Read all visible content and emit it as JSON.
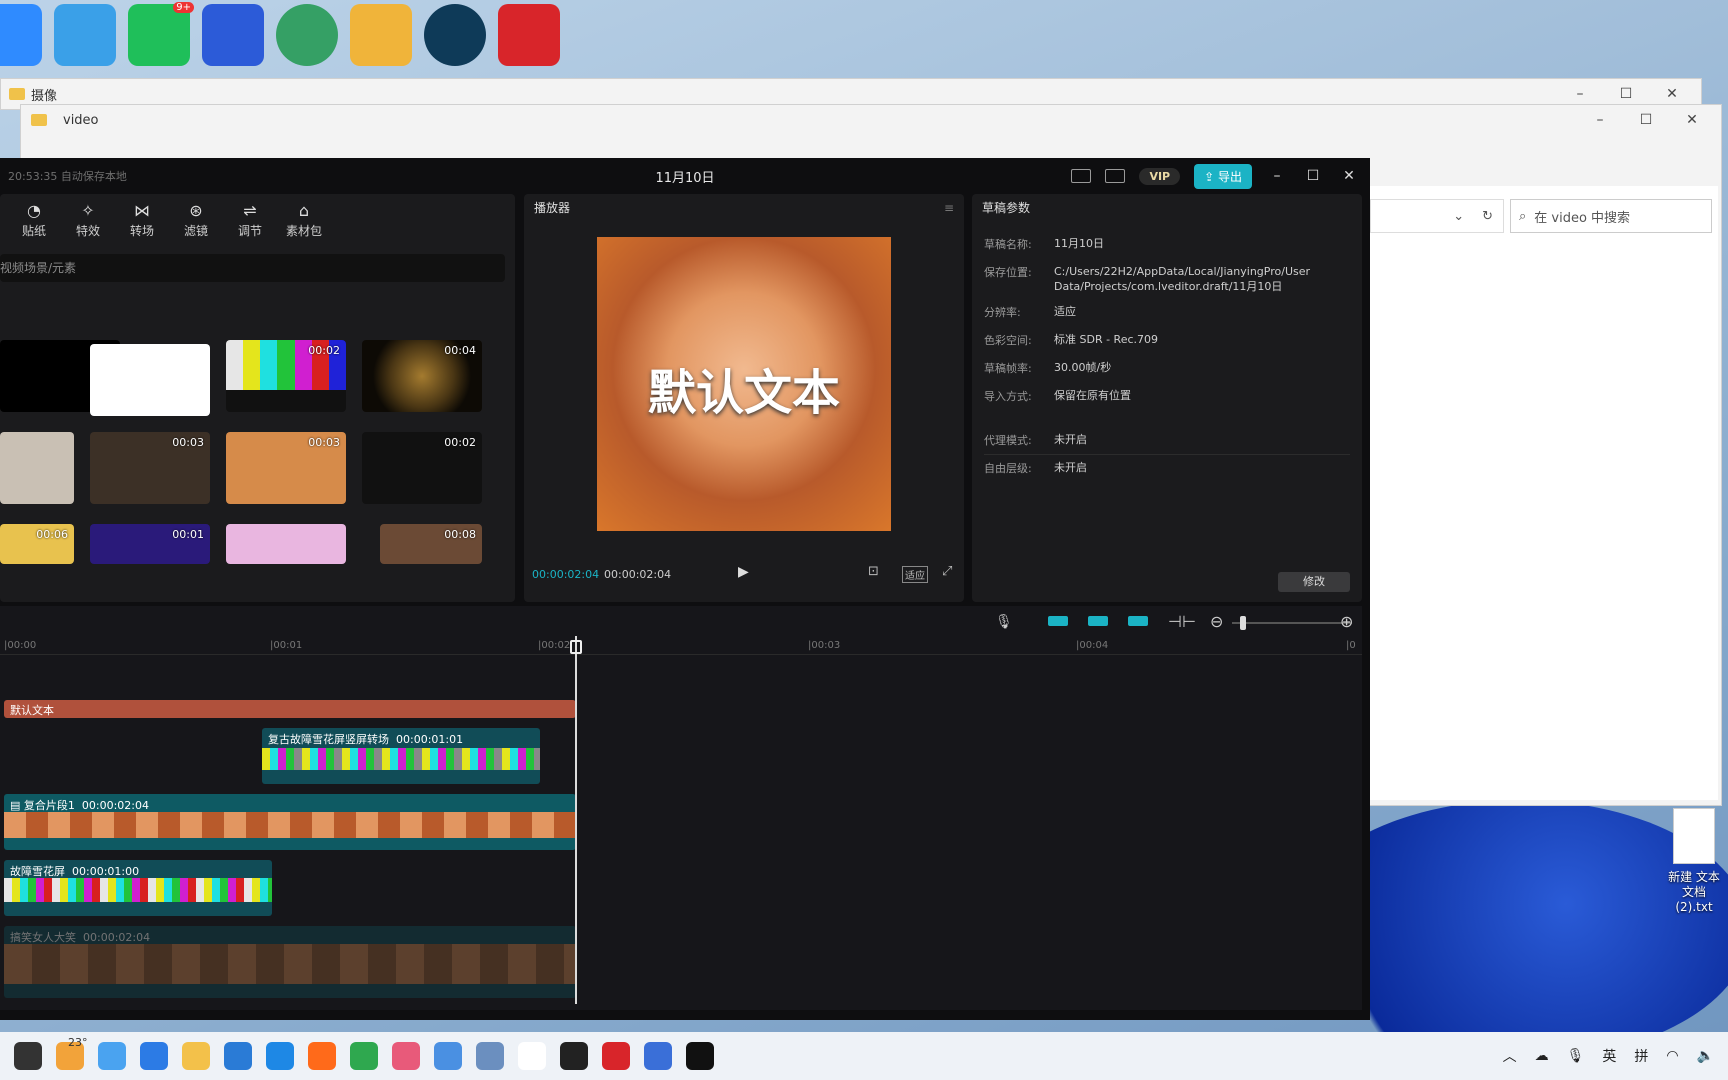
{
  "desktop": {
    "icon_colors": [
      "#2f8bff",
      "#3aa0e8",
      "#1fbf5a",
      "#2c5bd8",
      "#35a065",
      "#f0b43a",
      "#0e3a58",
      "#d8252a"
    ],
    "badge": "9+",
    "file_name": "新建 文本文档 (2).txt",
    "weather": "23°"
  },
  "explorer_back": {
    "title": "摄像"
  },
  "explorer_front": {
    "title": "video",
    "search_placeholder": "在 video 中搜索"
  },
  "editor": {
    "autosave": "20:53:35 自动保存本地",
    "project_name": "11月10日",
    "vip_label": "VIP",
    "export_label": "导出",
    "tools": [
      {
        "label": "贴纸",
        "glyph": "◔"
      },
      {
        "label": "特效",
        "glyph": "✧"
      },
      {
        "label": "转场",
        "glyph": "⋈"
      },
      {
        "label": "滤镜",
        "glyph": "⊛"
      },
      {
        "label": "调节",
        "glyph": "⇌"
      },
      {
        "label": "素材包",
        "glyph": "⌂"
      }
    ],
    "media_search_placeholder": "视频场景/元素",
    "media_durations": [
      "00:02",
      "00:04",
      "00:03",
      "00:03",
      "00:02",
      "00:06",
      "00:01",
      "00:08"
    ],
    "player": {
      "title": "播放器",
      "current_time": "00:00:02:04",
      "total_time": "00:00:02:04",
      "fit_label": "适应"
    },
    "draft": {
      "title": "草稿参数",
      "rows": [
        {
          "k": "草稿名称:",
          "v": "11月10日"
        },
        {
          "k": "保存位置:",
          "v": "C:/Users/22H2/AppData/Local/JianyingPro/User Data/Projects/com.lveditor.draft/11月10日"
        },
        {
          "k": "分辨率:",
          "v": "适应"
        },
        {
          "k": "色彩空间:",
          "v": "标准 SDR - Rec.709"
        },
        {
          "k": "草稿帧率:",
          "v": "30.00帧/秒"
        },
        {
          "k": "导入方式:",
          "v": "保留在原有位置"
        },
        {
          "k": "代理模式:",
          "v": "未开启"
        },
        {
          "k": "自由层级:",
          "v": "未开启"
        }
      ],
      "modify_label": "修改"
    },
    "preview_caption": "默认文本",
    "ruler": [
      "|00:00",
      "|00:01",
      "|00:02",
      "|00:03",
      "|00:04",
      "|0"
    ],
    "clips": {
      "text": "默认文本",
      "transition": "复古故障雪花屏竖屏转场",
      "transition_dur": "00:00:01:01",
      "compound": "复合片段1",
      "compound_dur": "00:00:02:04",
      "glitch": "故障雪花屏",
      "glitch_dur": "00:00:01:00",
      "main": "搞笑女人大笑",
      "main_dur": "00:00:02:04"
    }
  },
  "taskbar": {
    "lang": "英",
    "ime": "拼"
  }
}
